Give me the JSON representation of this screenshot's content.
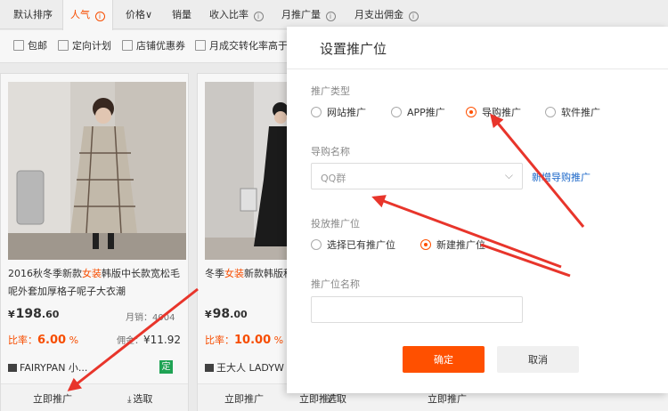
{
  "sort_bar": {
    "items": [
      {
        "label": "默认排序",
        "info": false,
        "active": false
      },
      {
        "label": "人气",
        "info": true,
        "active": true
      },
      {
        "label": "价格",
        "chevron": "∨",
        "active": false
      },
      {
        "label": "销量",
        "info": false,
        "active": false
      },
      {
        "label": "收入比率",
        "info": true,
        "active": false
      },
      {
        "label": "月推广量",
        "info": true,
        "active": false
      },
      {
        "label": "月支出佣金",
        "info": true,
        "active": false
      }
    ],
    "info_glyph": "i"
  },
  "filters": [
    "包邮",
    "定向计划",
    "店铺优惠券",
    "月成交转化率高于"
  ],
  "products": [
    {
      "title_pre": "2016秋冬季新款",
      "title_hl": "女装",
      "title_post": "韩版中长款宽松毛呢外套加厚格子呢子大衣潮",
      "currency": "¥",
      "price_int": "198",
      "price_dec": ".60",
      "monthly_label": "月销：",
      "monthly_value": "4004",
      "rate_label": "比率：",
      "rate_value": "6.00",
      "rate_unit": "%",
      "commission_label": "佣金：",
      "commission_value": "¥11.92",
      "shop": "FAIRYPAN 小...",
      "badge": "定",
      "promote_label": "立即推广",
      "select_label": "选取",
      "select_icon": "⤓"
    },
    {
      "title_pre": "冬季",
      "title_hl": "女装",
      "title_post": "新款韩版秋冬中长款加厚打",
      "currency": "¥",
      "price_int": "98",
      "price_dec": ".00",
      "rate_label": "比率：",
      "rate_value": "10.00",
      "rate_unit": "%",
      "shop": "王大人 LADYW",
      "promote_label": "立即推广",
      "select_label": "选取",
      "select_icon": "⤓"
    }
  ],
  "hidden_row_actions": [
    "立即推广",
    "选取",
    "立即推广"
  ],
  "dialog": {
    "title": "设置推广位",
    "promo_type_label": "推广类型",
    "promo_types": [
      {
        "label": "网站推广",
        "selected": false
      },
      {
        "label": "APP推广",
        "selected": false
      },
      {
        "label": "导购推广",
        "selected": true
      },
      {
        "label": "软件推广",
        "selected": false
      }
    ],
    "guide_name_label": "导购名称",
    "guide_name_value": "QQ群",
    "chevron": "⌵",
    "new_guide_link": "新增导购推广",
    "placement_label": "投放推广位",
    "placement_options": [
      {
        "label": "选择已有推广位",
        "selected": false
      },
      {
        "label": "新建推广位",
        "selected": true
      }
    ],
    "placement_name_label": "推广位名称",
    "placement_name_value": "",
    "ok_label": "确定",
    "cancel_label": "取消"
  },
  "colors": {
    "accent": "#ff5000",
    "link": "#1a66c8",
    "annotation": "#e8352b",
    "badge": "#21a957"
  }
}
